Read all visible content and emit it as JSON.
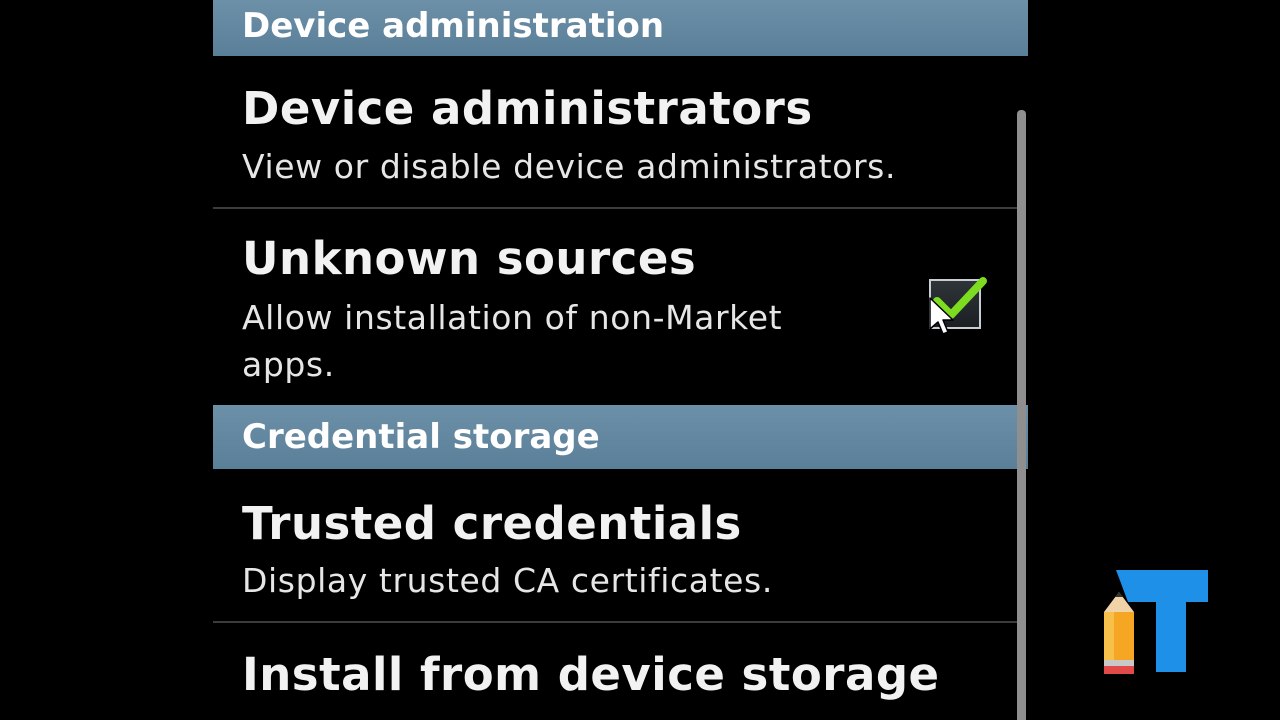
{
  "sections": {
    "device_admin": {
      "header": "Device administration"
    },
    "credential_storage": {
      "header": "Credential storage"
    }
  },
  "items": {
    "device_administrators": {
      "title": "Device administrators",
      "summary": "View or disable device administrators."
    },
    "unknown_sources": {
      "title": "Unknown sources",
      "summary_line1": "Allow installation of non-Market",
      "summary_line2": "apps.",
      "checked": true
    },
    "trusted_credentials": {
      "title": "Trusted credentials",
      "summary": "Display trusted CA certificates."
    },
    "install_from_storage": {
      "title": "Install from device storage"
    }
  },
  "colors": {
    "section_header": "#5f849c",
    "check": "#7ddc1f",
    "logo_blue": "#1e90e8",
    "pencil": "#f5a623"
  },
  "icons": {
    "checkbox": "checkmark-icon",
    "pointer": "mouse-pointer-icon",
    "logo": "channel-logo-icon"
  }
}
